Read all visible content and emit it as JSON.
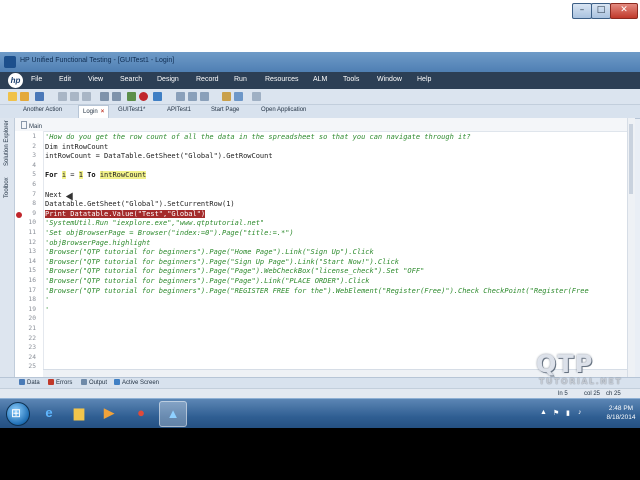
{
  "window": {
    "title": "HP Unified Functional Testing - [GUITest1 - Login]",
    "min_glyph": "–",
    "max_glyph": "□",
    "close_glyph": "✕"
  },
  "menu": [
    {
      "label": "File"
    },
    {
      "label": "Edit"
    },
    {
      "label": "View"
    },
    {
      "label": "Search"
    },
    {
      "label": "Design"
    },
    {
      "label": "Record"
    },
    {
      "label": "Run"
    },
    {
      "label": "Resources"
    },
    {
      "label": "ALM"
    },
    {
      "label": "Tools"
    },
    {
      "label": "Window"
    },
    {
      "label": "Help"
    }
  ],
  "hp_logo": "hp",
  "tabs": [
    {
      "label": "Another Action"
    },
    {
      "label": "Login",
      "active": true
    },
    {
      "label": "GUITest1*"
    },
    {
      "label": "APITest1"
    },
    {
      "label": "Start Page"
    },
    {
      "label": "Open Application"
    }
  ],
  "tab_close": "×",
  "left_panel": [
    "Solution Explorer",
    "Toolbox"
  ],
  "editor": {
    "scope": "Main",
    "lines": [
      {
        "n": "1",
        "text": "'How do you get the row count of all the data in the spreadsheet so that you can navigate through it?",
        "style": "comment"
      },
      {
        "n": "2",
        "text": "Dim intRowCount",
        "style": "code"
      },
      {
        "n": "3",
        "text": "intRowCount = DataTable.GetSheet(\"Global\").GetRowCount",
        "style": "code"
      },
      {
        "n": "4",
        "text": "",
        "style": "code"
      },
      {
        "n": "5",
        "text": "For i = 1 To intRowCount",
        "style": "code"
      },
      {
        "n": "6",
        "text": "",
        "style": "code"
      },
      {
        "n": "7",
        "text": "Next",
        "style": "code"
      },
      {
        "n": "8",
        "text": "Datatable.GetSheet(\"Global\").SetCurrentRow(1)",
        "style": "code"
      },
      {
        "n": "9",
        "text": "Print Datatable.Value(\"Test\",\"Global\")",
        "style": "breakpoint"
      },
      {
        "n": "10",
        "text": "'SystemUtil.Run \"iexplore.exe\",\"www.qtptutorial.net\"",
        "style": "comment"
      },
      {
        "n": "11",
        "text": "'Set objBrowserPage = Browser(\"index:=0\").Page(\"title:=.*\")",
        "style": "comment"
      },
      {
        "n": "12",
        "text": "'objBrowserPage.highlight",
        "style": "comment"
      },
      {
        "n": "13",
        "text": "'Browser(\"QTP tutorial for beginners\").Page(\"Home Page\").Link(\"Sign Up\").Click",
        "style": "comment"
      },
      {
        "n": "14",
        "text": "'Browser(\"QTP tutorial for beginners\").Page(\"Sign Up Page\").Link(\"Start Now!\").Click",
        "style": "comment"
      },
      {
        "n": "15",
        "text": "'Browser(\"QTP tutorial for beginners\").Page(\"Page\").WebCheckBox(\"license_check\").Set \"OFF\"",
        "style": "comment"
      },
      {
        "n": "16",
        "text": "'Browser(\"QTP tutorial for beginners\").Page(\"Page\").Link(\"PLACE ORDER\").Click",
        "style": "comment"
      },
      {
        "n": "17",
        "text": "'Browser(\"QTP tutorial for beginners\").Page(\"REGISTER FREE for the\").WebElement(\"Register(Free)\").Check CheckPoint(\"Register(Free",
        "style": "comment"
      },
      {
        "n": "18",
        "text": "'",
        "style": "comment"
      },
      {
        "n": "19",
        "text": "'",
        "style": "comment"
      },
      {
        "n": "20",
        "text": "",
        "style": "code"
      },
      {
        "n": "21",
        "text": "",
        "style": "code"
      },
      {
        "n": "22",
        "text": "",
        "style": "code"
      },
      {
        "n": "23",
        "text": "",
        "style": "code"
      },
      {
        "n": "24",
        "text": "",
        "style": "code"
      },
      {
        "n": "25",
        "text": "",
        "style": "code"
      }
    ],
    "line5": {
      "kw_for": "For ",
      "var": "i",
      "mid": " = ",
      "one": "1",
      "kw_to": " To ",
      "count": "intRowCount"
    }
  },
  "bottom_tabs": [
    {
      "label": "Data",
      "icon_color": "#4a7bb7"
    },
    {
      "label": "Errors",
      "icon_color": "#c0392b"
    },
    {
      "label": "Output",
      "icon_color": "#6f8aa8"
    },
    {
      "label": "Active Screen",
      "icon_color": "#3f7fc4"
    }
  ],
  "status": {
    "ln": "ln 5",
    "col": "col 25",
    "ch": "ch 25"
  },
  "watermark": {
    "big": "QTP",
    "sub": "TUTORIAL.NET"
  },
  "taskbar": {
    "apps": [
      {
        "icon": "internet-explorer-icon",
        "glyph": "e",
        "color": "#5fb7ff"
      },
      {
        "icon": "folder-icon",
        "glyph": "▆",
        "color": "#f3c64c"
      },
      {
        "icon": "media-player-icon",
        "glyph": "▶",
        "color": "#f0a23a"
      },
      {
        "icon": "chrome-icon",
        "glyph": "●",
        "color": "#e04a3a"
      },
      {
        "icon": "uft-icon",
        "glyph": "▲",
        "color": "#8fd0ff"
      }
    ],
    "tray_icons": [
      "▲",
      "⚑",
      "▮",
      "♪"
    ],
    "time": "2:48 PM",
    "date": "8/18/2014"
  }
}
